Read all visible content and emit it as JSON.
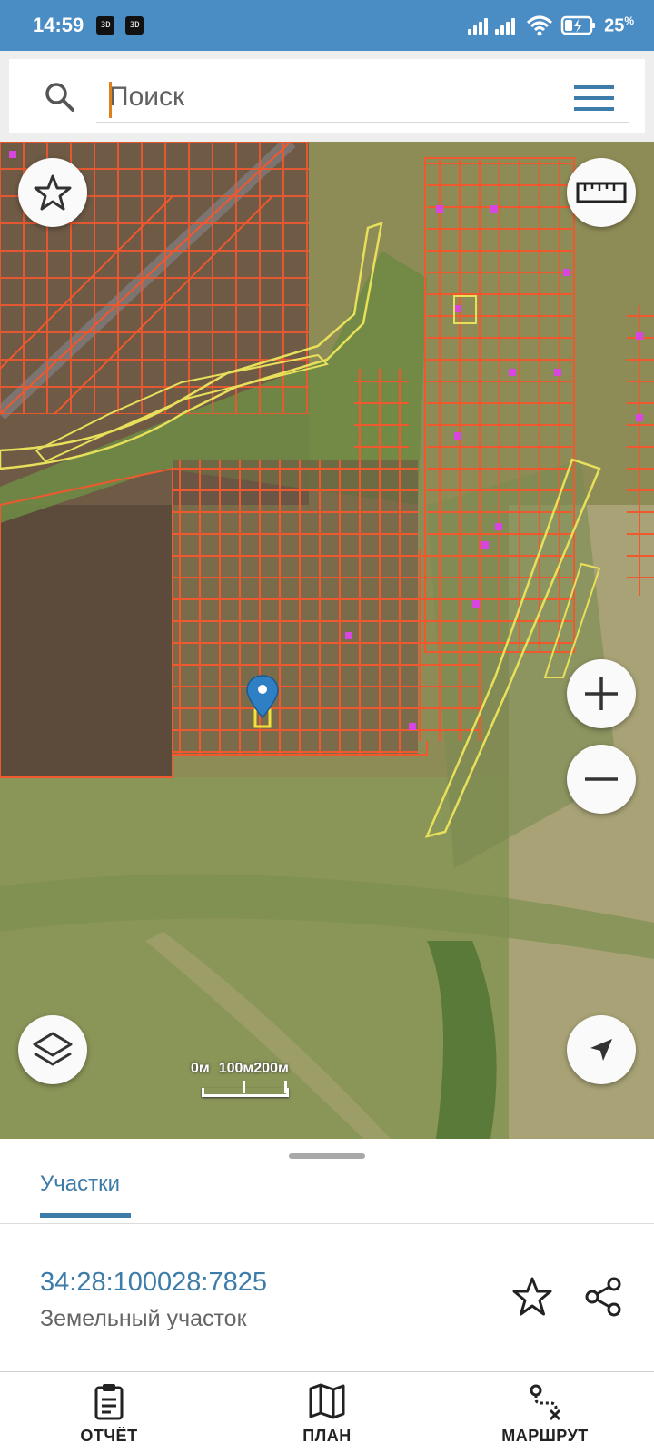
{
  "status_bar": {
    "time": "14:59",
    "badges": [
      "3D",
      "3D"
    ],
    "battery_value": "25",
    "battery_unit": "%"
  },
  "search": {
    "placeholder": "Поиск",
    "icon": "search-icon",
    "menu_icon": "menu-icon"
  },
  "map": {
    "scale_labels": [
      "0м",
      "100м",
      "200м"
    ],
    "buttons": {
      "favorite": "star-icon",
      "ruler": "ruler-icon",
      "zoom_in": "plus-icon",
      "zoom_out": "minus-icon",
      "layers": "layers-icon",
      "locate": "navigation-arrow-icon"
    },
    "colors": {
      "parcel_border": "#f0582e",
      "zone_border": "#e8e05a",
      "building": "#d845e0",
      "marker": "#2e7fc4"
    }
  },
  "sheet": {
    "tab_label": "Участки",
    "parcel_id": "34:28:100028:7825",
    "parcel_type": "Земельный участок"
  },
  "bottom_nav": {
    "items": [
      {
        "label": "ОТЧЁТ",
        "icon": "report-clipboard-icon"
      },
      {
        "label": "ПЛАН",
        "icon": "map-plan-icon"
      },
      {
        "label": "МАРШРУТ",
        "icon": "route-icon"
      }
    ]
  },
  "theme": {
    "accent": "#3d7ca8",
    "status_bar": "#4a8cc4"
  }
}
